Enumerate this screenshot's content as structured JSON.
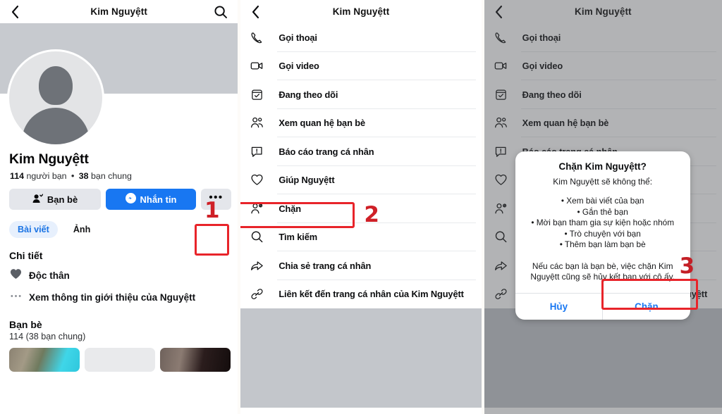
{
  "header": {
    "title": "Kim Nguyệtt",
    "back_icon": "chevron-left-icon",
    "search_icon": "search-icon"
  },
  "profile": {
    "name": "Kim Nguyệtt",
    "friends_count": "114",
    "friends_label": "người bạn",
    "separator": "•",
    "mutual_count": "38",
    "mutual_label": "bạn chung",
    "buttons": {
      "friends": "Bạn bè",
      "message": "Nhắn tin",
      "more": "•••"
    },
    "tabs": [
      {
        "label": "Bài viết",
        "active": true
      },
      {
        "label": "Ảnh",
        "active": false
      }
    ],
    "details_title": "Chi tiết",
    "details": [
      {
        "icon": "heart-icon",
        "label": "Độc thân"
      },
      {
        "icon": "ellipsis-icon",
        "label": "Xem thông tin giới thiệu của Nguyệtt"
      }
    ],
    "friends_section": {
      "title": "Bạn bè",
      "subtitle": "114 (38 bạn chung)"
    }
  },
  "menu": {
    "items": [
      {
        "icon": "phone-icon",
        "label": "Gọi thoại"
      },
      {
        "icon": "video-camera-icon",
        "label": "Gọi video"
      },
      {
        "icon": "following-check-icon",
        "label": "Đang theo dõi"
      },
      {
        "icon": "people-icon",
        "label": "Xem quan hệ bạn bè"
      },
      {
        "icon": "report-icon",
        "label": "Báo cáo trang cá nhân"
      },
      {
        "icon": "shield-heart-icon",
        "label": "Giúp Nguyệtt"
      },
      {
        "icon": "block-person-icon",
        "label": "Chặn"
      },
      {
        "icon": "search-icon",
        "label": "Tìm kiếm"
      },
      {
        "icon": "share-arrow-icon",
        "label": "Chia sẻ trang cá nhân"
      },
      {
        "icon": "link-icon",
        "label": "Liên kết đến trang cá nhân của Kim Nguyệtt"
      }
    ]
  },
  "dialog": {
    "title": "Chặn Kim Nguyệtt?",
    "subtitle": "Kim Nguyệtt sẽ không thể:",
    "bullets": [
      "• Xem bài viết của bạn",
      "• Gắn thẻ bạn",
      "• Mời bạn tham gia sự kiện hoặc nhóm",
      "• Trò chuyện với bạn",
      "• Thêm bạn làm bạn bè"
    ],
    "note": "Nếu các bạn là bạn bè, việc chặn Kim Nguyệtt cũng sẽ hủy kết bạn với cô ấy.",
    "cancel_label": "Hủy",
    "confirm_label": "Chặn"
  },
  "annotations": {
    "step1": "1",
    "step2": "2",
    "step3": "3",
    "color": "#e8242a"
  },
  "colors": {
    "accent_blue": "#1877f2",
    "tab_active_bg": "#e7f0fd",
    "tab_active_text": "#1b74e4",
    "button_grey": "#e4e6eb",
    "cover_grey": "#c7cacf",
    "annotation_red": "#e8242a"
  }
}
